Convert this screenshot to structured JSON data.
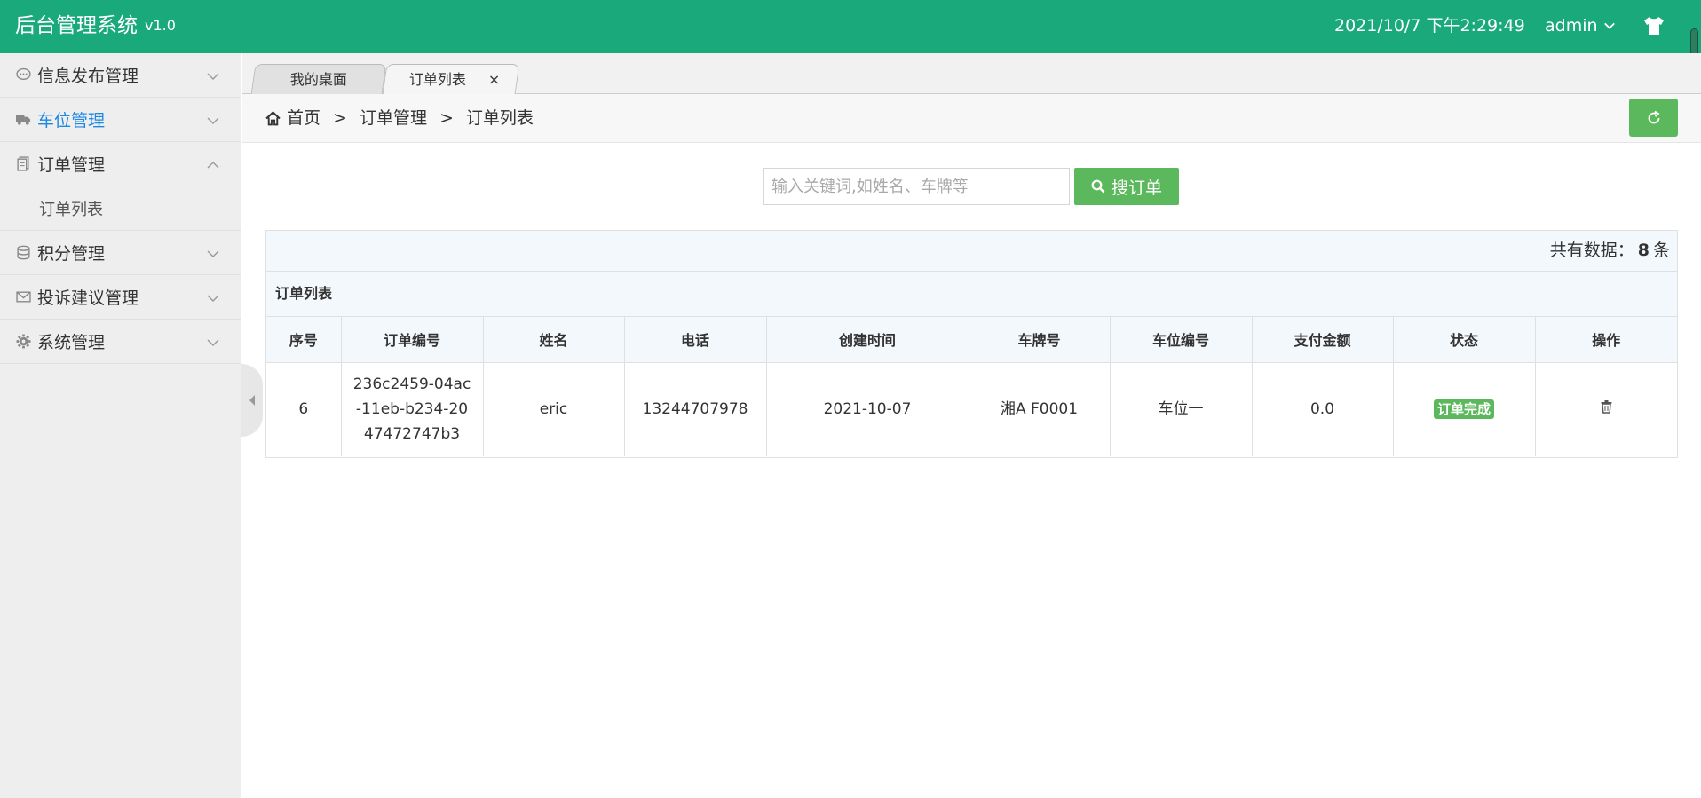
{
  "header": {
    "brand": "后台管理系统",
    "version": "v1.0",
    "datetime": "2021/10/7 下午2:29:49",
    "user": "admin",
    "theme_icon": "tshirt-icon",
    "background_color": "#1aa97b"
  },
  "sidebar": {
    "items": [
      {
        "label": "信息发布管理",
        "icon": "comment-icon",
        "expanded": false
      },
      {
        "label": "车位管理",
        "icon": "truck-icon",
        "expanded": false,
        "active": true
      },
      {
        "label": "订单管理",
        "icon": "file-icon",
        "expanded": true,
        "children": [
          {
            "label": "订单列表"
          }
        ]
      },
      {
        "label": "积分管理",
        "icon": "database-icon",
        "expanded": false
      },
      {
        "label": "投诉建议管理",
        "icon": "envelope-icon",
        "expanded": false
      },
      {
        "label": "系统管理",
        "icon": "gear-icon",
        "expanded": false
      }
    ]
  },
  "tabs": [
    {
      "label": "我的桌面",
      "active": false
    },
    {
      "label": "订单列表",
      "active": true,
      "close": "×"
    }
  ],
  "breadcrumb": {
    "home": "首页",
    "separator": ">",
    "level1": "订单管理",
    "level2": "订单列表"
  },
  "search": {
    "placeholder": "输入关键词,如姓名、车牌等",
    "value": "",
    "button_label": "搜订单"
  },
  "summary": {
    "prefix": "共有数据：",
    "count": "8",
    "suffix": "条"
  },
  "table": {
    "title": "订单列表",
    "columns": [
      "序号",
      "订单编号",
      "姓名",
      "电话",
      "创建时间",
      "车牌号",
      "车位编号",
      "支付金额",
      "状态",
      "操作"
    ],
    "rows": [
      {
        "index": "6",
        "order_no": "236c2459-04ac-11eb-b234-2047472747b3",
        "name": "eric",
        "phone": "13244707978",
        "created": "2021-10-07",
        "plate": "湘A F0001",
        "space": "车位一",
        "amount": "0.0",
        "status": "订单完成",
        "action_icon": "trash-icon"
      }
    ]
  },
  "colors": {
    "accent_green": "#5cb85c",
    "active_blue": "#1e88e5"
  }
}
